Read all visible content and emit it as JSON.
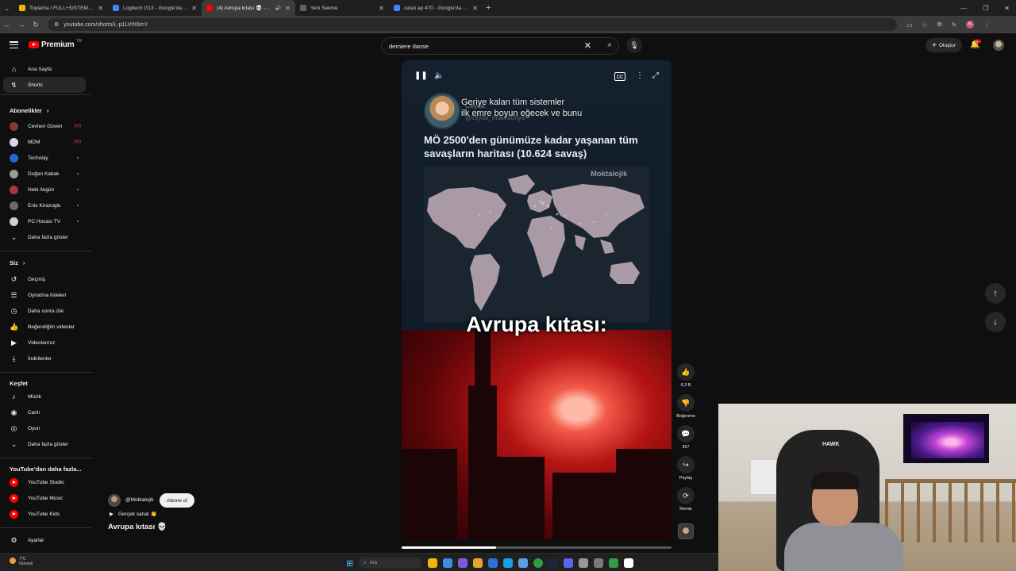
{
  "browser": {
    "tabs": [
      {
        "title": "Toplama / FULL+SİSTEM sahibi",
        "color": "#f2b705",
        "active": false,
        "audio": false
      },
      {
        "title": "Logitech G13 - Google'da Ara",
        "color": "#4285f4",
        "active": false,
        "audio": false
      },
      {
        "title": "(4) Avrupa kıtası 💀 - YouT",
        "color": "#ff0000",
        "active": true,
        "audio": true
      },
      {
        "title": "Yeni Sekme",
        "color": "#5f6368",
        "active": false,
        "audio": false
      },
      {
        "title": "casio ap 470 - Google'da Ara",
        "color": "#4285f4",
        "active": false,
        "audio": false
      }
    ],
    "url": "youtube.com/shorts/L-p1LVtX6mY"
  },
  "header": {
    "logo_text": "Premium",
    "logo_region": "TR",
    "search_value": "derniere danse",
    "create_label": "Oluştur",
    "notification_count": "9+"
  },
  "sidebar": {
    "main": [
      {
        "label": "Ana Sayfa",
        "icon": "home-icon",
        "glyph": "⌂",
        "active": false
      },
      {
        "label": "Shorts",
        "icon": "shorts-icon",
        "glyph": "↯",
        "active": true
      }
    ],
    "subscriptions_title": "Abonelikler",
    "subscriptions": [
      {
        "label": "Cevheri Güven",
        "color": "#7a3e2a",
        "status": "live"
      },
      {
        "label": "MDM",
        "color": "#d7d7e8",
        "status": "live"
      },
      {
        "label": "Techolay",
        "color": "#2a65d4",
        "status": "new"
      },
      {
        "label": "Doğan Kabak",
        "color": "#9a9a9a",
        "status": "new"
      },
      {
        "label": "Nebi Akgün",
        "color": "#a03a3a",
        "status": "new"
      },
      {
        "label": "Enis Kirazoglu",
        "color": "#6b6b6b",
        "status": "new"
      },
      {
        "label": "PC Hocası TV",
        "color": "#cfcfcf",
        "status": "new"
      }
    ],
    "subs_more": "Daha fazla göster",
    "you_title": "Siz",
    "you": [
      {
        "label": "Geçmiş",
        "icon": "history-icon",
        "glyph": "↺"
      },
      {
        "label": "Oynatma listeleri",
        "icon": "playlist-icon",
        "glyph": "☰"
      },
      {
        "label": "Daha sonra izle",
        "icon": "watch-later-icon",
        "glyph": "◷"
      },
      {
        "label": "Beğendiğim videolar",
        "icon": "liked-icon",
        "glyph": "👍"
      },
      {
        "label": "Videolarınız",
        "icon": "your-videos-icon",
        "glyph": "▶"
      },
      {
        "label": "İndirilenler",
        "icon": "download-icon",
        "glyph": "⤓"
      }
    ],
    "explore_title": "Keşfet",
    "explore": [
      {
        "label": "Müzik",
        "icon": "music-icon",
        "glyph": "♪"
      },
      {
        "label": "Canlı",
        "icon": "live-icon",
        "glyph": "◉"
      },
      {
        "label": "Oyun",
        "icon": "gaming-icon",
        "glyph": "◎"
      }
    ],
    "explore_more": "Daha fazla göster",
    "more_title": "YouTube'dan daha fazla...",
    "more": [
      {
        "label": "YouTube Studio"
      },
      {
        "label": "YouTube Music"
      },
      {
        "label": "YouTube Kids"
      }
    ],
    "settings": "Ayarlar"
  },
  "short": {
    "channel": "@Moktalojik",
    "subscribe": "Abone ol",
    "sound": "Gerçek sanat 👏",
    "title": "Avrupa kıtası 💀",
    "overlay_line1": "Geriye kalan tüm sistemler",
    "overlay_line2": "ilk emre boyun eğecek ve bunu",
    "ghost_name": "Ceyda",
    "ghost_handle": "@ceyda_makedonya",
    "headline": "MÖ 2500'den günümüze kadar yaşanan tüm savaşların haritası (10.624 savaş)",
    "watermark": "Moktalojik",
    "caption": "Avrupa kıtası:",
    "progress": 0.35
  },
  "actions": [
    {
      "name": "like",
      "glyph": "👍",
      "label": "6,3 B"
    },
    {
      "name": "dislike",
      "glyph": "👎",
      "label": "Beğenme"
    },
    {
      "name": "comments",
      "glyph": "💬",
      "label": "367"
    },
    {
      "name": "share",
      "glyph": "↪",
      "label": "Paylaş"
    },
    {
      "name": "remix",
      "glyph": "⟳",
      "label": "Remix"
    }
  ],
  "webcam": {
    "chair_logo": "HAWK"
  },
  "taskbar": {
    "weather_temp": "7°C",
    "weather_text": "Güneşli",
    "search_placeholder": "Ara",
    "app_colors": [
      "#f2b705",
      "#3a8ee6",
      "#7b5cd6",
      "#e6a42b",
      "#2e6fd6",
      "#1aa0e6",
      "#5aa0e6",
      "#2e9d44",
      "#1b2838",
      "#5865f2",
      "#999999",
      "#7a7a7a",
      "#2e9d44",
      "#ffffff"
    ]
  }
}
